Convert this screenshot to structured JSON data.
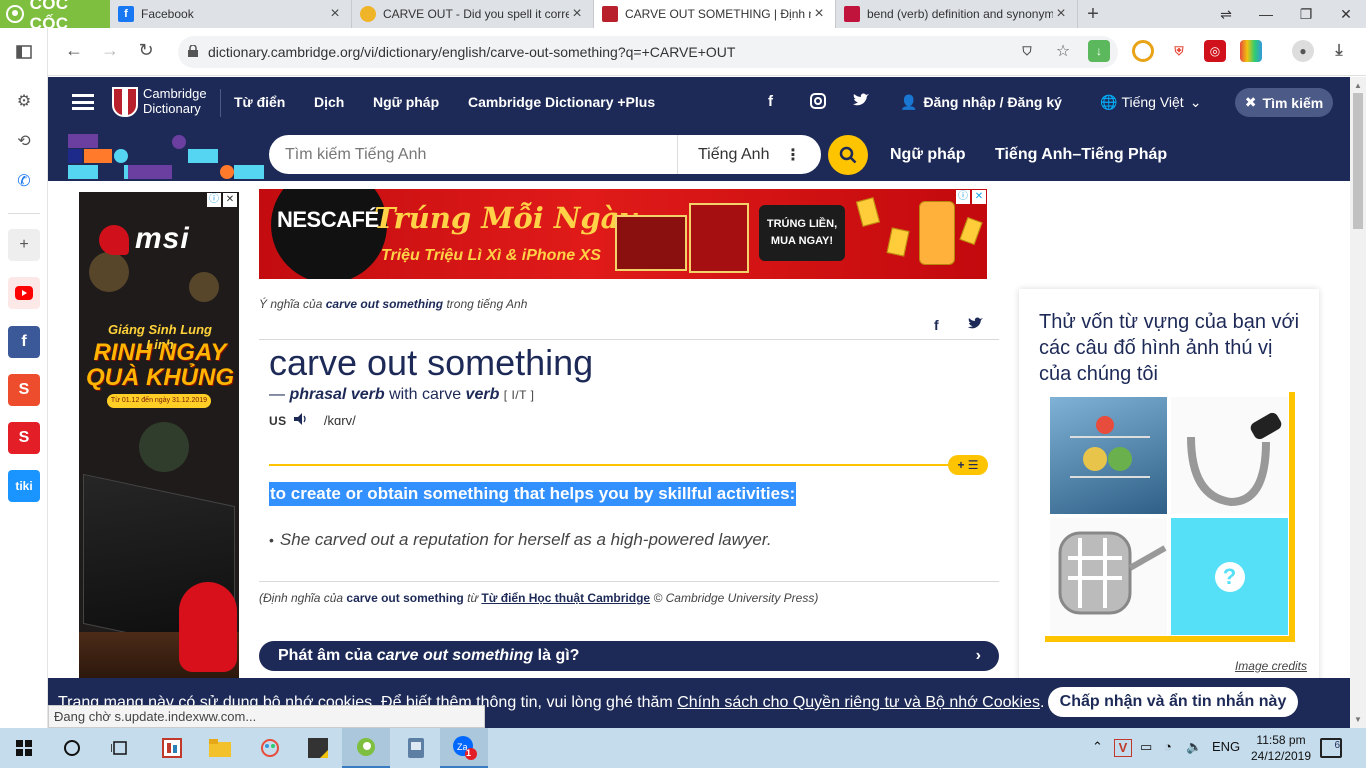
{
  "browser": {
    "brand": "CỐC CỐC",
    "tabs": [
      {
        "title": "Facebook",
        "color": "#1877f2",
        "glyph": "f"
      },
      {
        "title": "CARVE OUT - Did you spell it corre",
        "color": "#f0b429",
        "glyph": ""
      },
      {
        "title": "CARVE OUT SOMETHING | Định ng",
        "color": "#b8202c",
        "glyph": ""
      },
      {
        "title": "bend (verb) definition and synonym",
        "color": "#c0143c",
        "glyph": ""
      }
    ],
    "url": "dictionary.cambridge.org/vi/dictionary/english/carve-out-something?q=+CARVE+OUT"
  },
  "site": {
    "logo_line1": "Cambridge",
    "logo_line2": "Dictionary",
    "menu": [
      "Từ điển",
      "Dịch",
      "Ngữ pháp",
      "Cambridge Dictionary +Plus"
    ],
    "login": "Đăng nhập / Đăng ký",
    "language": "Tiếng Việt",
    "search_btn": "Tìm kiếm",
    "search_placeholder": "Tìm kiếm Tiếng Anh",
    "search_lang": "Tiếng Anh",
    "links": [
      "Ngữ pháp",
      "Tiếng Anh–Tiếng Pháp"
    ]
  },
  "ads": {
    "left": {
      "brand": "msi",
      "promo1": "Giáng Sinh Lung Linh",
      "promo2": "RINH NGAY QUÀ KHỦNG",
      "dates": "Từ 01.12 đến ngày 31.12.2019"
    },
    "top": {
      "brand": "NESCAFÉ",
      "headline": "Trúng Mỗi Ngày",
      "subline": "Triệu Triệu Lì Xì & iPhone XS",
      "slogan": "TRÚNG LIỀN, MUA NGAY!"
    }
  },
  "entry": {
    "crumb_pre": "Ý nghĩa của",
    "crumb_word": "carve out something",
    "crumb_post": "trong tiếng Anh",
    "headword": "carve out something",
    "pos_dash": "—",
    "pos": "phrasal verb",
    "pos_with": "with carve",
    "pos_verb": "verb",
    "gram": "[ I/T ]",
    "region": "US",
    "ipa": "/kɑrv/",
    "definition": "to create or obtain something that helps you by skillful activities:",
    "example": "She carved out a reputation for herself as a high-powered lawyer.",
    "source_pre": "(Định nghĩa của",
    "source_word": "carve out something",
    "source_mid": "từ",
    "source_link": "Từ điển Học thuật Cambridge",
    "source_post": "© Cambridge University Press)",
    "pron_pre": "Phát âm của",
    "pron_word": "carve out something",
    "pron_post": "là gì?"
  },
  "quiz": {
    "title": "Thử vốn từ vựng của bạn với các câu đố hình ảnh thú vị của chúng tôi",
    "credits": "Image credits",
    "mystery": "?"
  },
  "cookie": {
    "text_pre": "Trang mạng này có sử dụng bộ nhớ cookies. Để biết thêm thông tin, vui lòng ghé thăm",
    "link": "Chính sách cho Quyền riêng tư và Bộ nhớ Cookies",
    "accept": "Chấp nhận và ẩn tin nhắn này"
  },
  "status": "Đang chờ s.update.indexww.com...",
  "taskbar": {
    "lang": "ENG",
    "time": "11:58 pm",
    "date": "24/12/2019",
    "notif_count": "6",
    "zalo_badge": "1"
  }
}
